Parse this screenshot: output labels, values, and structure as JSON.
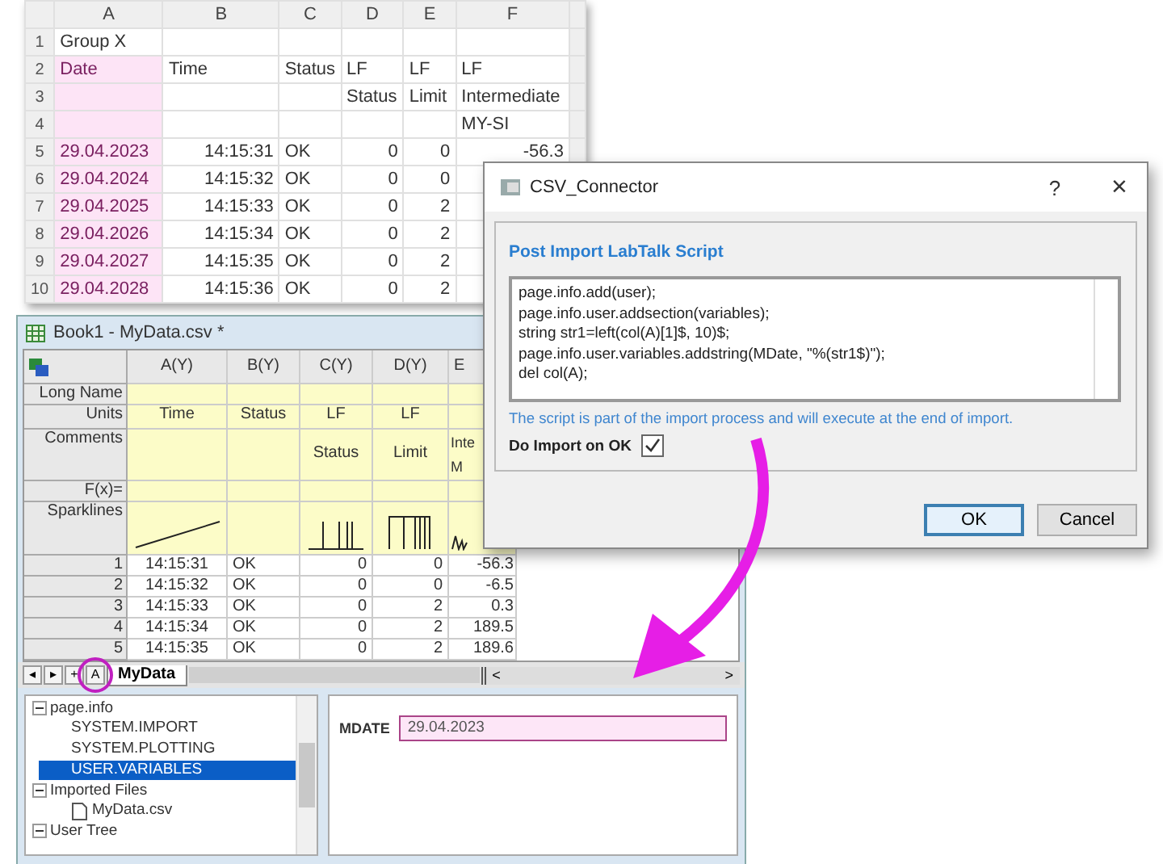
{
  "spreadsheet": {
    "columns": [
      "A",
      "B",
      "C",
      "D",
      "E",
      "F"
    ],
    "rows": [
      {
        "number": "1",
        "cells": [
          "Group X",
          "",
          "",
          "",
          "",
          ""
        ]
      },
      {
        "number": "2",
        "cells": [
          "Date",
          "Time",
          "Status",
          "LF",
          "LF",
          "LF"
        ]
      },
      {
        "number": "3",
        "cells": [
          "",
          "",
          "",
          "Status",
          "Limit",
          "Intermediate"
        ]
      },
      {
        "number": "4",
        "cells": [
          "",
          "",
          "",
          "",
          "",
          "MY-SI"
        ]
      },
      {
        "number": "5",
        "cells": [
          "29.04.2023",
          "14:15:31",
          "OK",
          "0",
          "0",
          "-56.3"
        ]
      },
      {
        "number": "6",
        "cells": [
          "29.04.2024",
          "14:15:32",
          "OK",
          "0",
          "0",
          ""
        ]
      },
      {
        "number": "7",
        "cells": [
          "29.04.2025",
          "14:15:33",
          "OK",
          "0",
          "2",
          ""
        ]
      },
      {
        "number": "8",
        "cells": [
          "29.04.2026",
          "14:15:34",
          "OK",
          "0",
          "2",
          ""
        ]
      },
      {
        "number": "9",
        "cells": [
          "29.04.2027",
          "14:15:35",
          "OK",
          "0",
          "2",
          ""
        ]
      },
      {
        "number": "10",
        "cells": [
          "29.04.2028",
          "14:15:36",
          "OK",
          "0",
          "2",
          ""
        ]
      }
    ]
  },
  "workbook": {
    "title": "Book1 - MyData.csv *",
    "row_labels": [
      "Long Name",
      "Units",
      "Comments",
      "F(x)=",
      "Sparklines"
    ],
    "columns": [
      {
        "name": "A(Y)",
        "units": "Time"
      },
      {
        "name": "B(Y)",
        "units": "Status"
      },
      {
        "name": "C(Y)",
        "units": "LF",
        "comments": [
          "Status"
        ]
      },
      {
        "name": "D(Y)",
        "units": "LF",
        "comments": [
          "Limit"
        ]
      },
      {
        "name": "E",
        "comments": [
          "Inte",
          "M"
        ]
      }
    ],
    "rows": [
      {
        "number": "1",
        "cells": [
          "14:15:31",
          "OK",
          "0",
          "0",
          "-56.3"
        ]
      },
      {
        "number": "2",
        "cells": [
          "14:15:32",
          "OK",
          "0",
          "0",
          "-6.5"
        ]
      },
      {
        "number": "3",
        "cells": [
          "14:15:33",
          "OK",
          "0",
          "2",
          "0.3"
        ]
      },
      {
        "number": "4",
        "cells": [
          "14:15:34",
          "OK",
          "0",
          "2",
          "189.5"
        ]
      },
      {
        "number": "5",
        "cells": [
          "14:15:35",
          "OK",
          "0",
          "2",
          "189.6"
        ]
      }
    ],
    "sheet_nav": [
      "◂",
      "▸",
      "+",
      "A"
    ],
    "sheet_tab": "MyData",
    "scroll_left": "<",
    "scroll_right": ">",
    "tree": [
      {
        "label": "page.info",
        "expanded": true,
        "selected": false,
        "children": [
          {
            "label": "SYSTEM.IMPORT",
            "selected": false
          },
          {
            "label": "SYSTEM.PLOTTING",
            "selected": false
          },
          {
            "label": "USER.VARIABLES",
            "selected": true
          }
        ]
      },
      {
        "label": "Imported Files",
        "expanded": true,
        "selected": false,
        "children": [
          {
            "label": "MyData.csv",
            "selected": false
          }
        ]
      },
      {
        "label": "User Tree",
        "expanded": true,
        "selected": false
      }
    ],
    "variable": {
      "label": "MDATE",
      "value": "29.04.2023"
    }
  },
  "dialog": {
    "title": "CSV_Connector",
    "help": "?",
    "close": "×",
    "section": "Post Import LabTalk Script",
    "script_lines": [
      "page.info.add(user);",
      "page.info.user.addsection(variables);",
      "string str1=left(col(A)[1]$, 10)$;",
      "page.info.user.variables.addstring(MDate, \"%(str1$)\");",
      "del col(A);"
    ],
    "note": "The script is part of the import process and will execute at the end of import.",
    "checkbox": {
      "label": "Do Import on OK",
      "checked": true
    },
    "buttons": [
      {
        "label": "OK",
        "default": true
      },
      {
        "label": "Cancel",
        "default": false
      }
    ]
  }
}
